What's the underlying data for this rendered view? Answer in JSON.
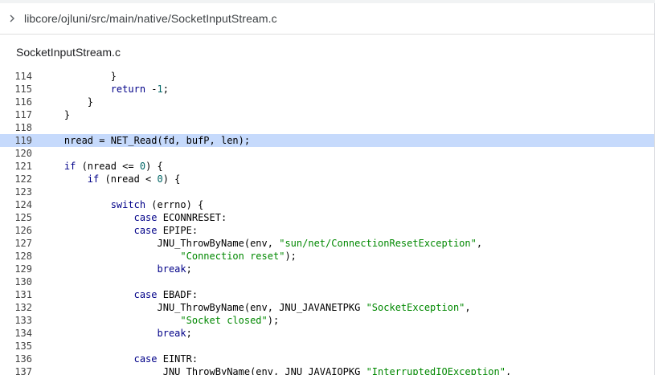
{
  "breadcrumb": {
    "path": "libcore/ojluni/src/main/native/SocketInputStream.c",
    "expand_icon": "chevron-right-icon"
  },
  "file_header": {
    "title": "SocketInputStream.c"
  },
  "code": {
    "highlighted_line": 119,
    "lines": [
      {
        "n": "114",
        "tokens": [
          {
            "t": "            }",
            "c": "pln"
          }
        ]
      },
      {
        "n": "115",
        "tokens": [
          {
            "t": "            ",
            "c": "pln"
          },
          {
            "t": "return",
            "c": "kw"
          },
          {
            "t": " -",
            "c": "pln"
          },
          {
            "t": "1",
            "c": "num"
          },
          {
            "t": ";",
            "c": "pln"
          }
        ]
      },
      {
        "n": "116",
        "tokens": [
          {
            "t": "        }",
            "c": "pln"
          }
        ]
      },
      {
        "n": "117",
        "tokens": [
          {
            "t": "    }",
            "c": "pln"
          }
        ]
      },
      {
        "n": "118",
        "tokens": [
          {
            "t": "",
            "c": "pln"
          }
        ]
      },
      {
        "n": "119",
        "tokens": [
          {
            "t": "    nread = NET_Read(fd, bufP, len);",
            "c": "pln"
          }
        ]
      },
      {
        "n": "120",
        "tokens": [
          {
            "t": "",
            "c": "pln"
          }
        ]
      },
      {
        "n": "121",
        "tokens": [
          {
            "t": "    ",
            "c": "pln"
          },
          {
            "t": "if",
            "c": "kw"
          },
          {
            "t": " (nread <= ",
            "c": "pln"
          },
          {
            "t": "0",
            "c": "num"
          },
          {
            "t": ") {",
            "c": "pln"
          }
        ]
      },
      {
        "n": "122",
        "tokens": [
          {
            "t": "        ",
            "c": "pln"
          },
          {
            "t": "if",
            "c": "kw"
          },
          {
            "t": " (nread < ",
            "c": "pln"
          },
          {
            "t": "0",
            "c": "num"
          },
          {
            "t": ") {",
            "c": "pln"
          }
        ]
      },
      {
        "n": "123",
        "tokens": [
          {
            "t": "",
            "c": "pln"
          }
        ]
      },
      {
        "n": "124",
        "tokens": [
          {
            "t": "            ",
            "c": "pln"
          },
          {
            "t": "switch",
            "c": "kw"
          },
          {
            "t": " (errno) {",
            "c": "pln"
          }
        ]
      },
      {
        "n": "125",
        "tokens": [
          {
            "t": "                ",
            "c": "pln"
          },
          {
            "t": "case",
            "c": "kw"
          },
          {
            "t": " ECONNRESET:",
            "c": "pln"
          }
        ]
      },
      {
        "n": "126",
        "tokens": [
          {
            "t": "                ",
            "c": "pln"
          },
          {
            "t": "case",
            "c": "kw"
          },
          {
            "t": " EPIPE:",
            "c": "pln"
          }
        ]
      },
      {
        "n": "127",
        "tokens": [
          {
            "t": "                    JNU_ThrowByName(env, ",
            "c": "pln"
          },
          {
            "t": "\"sun/net/ConnectionResetException\"",
            "c": "str"
          },
          {
            "t": ",",
            "c": "pln"
          }
        ]
      },
      {
        "n": "128",
        "tokens": [
          {
            "t": "                        ",
            "c": "pln"
          },
          {
            "t": "\"Connection reset\"",
            "c": "str"
          },
          {
            "t": ");",
            "c": "pln"
          }
        ]
      },
      {
        "n": "129",
        "tokens": [
          {
            "t": "                    ",
            "c": "pln"
          },
          {
            "t": "break",
            "c": "kw"
          },
          {
            "t": ";",
            "c": "pln"
          }
        ]
      },
      {
        "n": "130",
        "tokens": [
          {
            "t": "",
            "c": "pln"
          }
        ]
      },
      {
        "n": "131",
        "tokens": [
          {
            "t": "                ",
            "c": "pln"
          },
          {
            "t": "case",
            "c": "kw"
          },
          {
            "t": " EBADF:",
            "c": "pln"
          }
        ]
      },
      {
        "n": "132",
        "tokens": [
          {
            "t": "                    JNU_ThrowByName(env, JNU_JAVANETPKG ",
            "c": "pln"
          },
          {
            "t": "\"SocketException\"",
            "c": "str"
          },
          {
            "t": ",",
            "c": "pln"
          }
        ]
      },
      {
        "n": "133",
        "tokens": [
          {
            "t": "                        ",
            "c": "pln"
          },
          {
            "t": "\"Socket closed\"",
            "c": "str"
          },
          {
            "t": ");",
            "c": "pln"
          }
        ]
      },
      {
        "n": "134",
        "tokens": [
          {
            "t": "                    ",
            "c": "pln"
          },
          {
            "t": "break",
            "c": "kw"
          },
          {
            "t": ";",
            "c": "pln"
          }
        ]
      },
      {
        "n": "135",
        "tokens": [
          {
            "t": "",
            "c": "pln"
          }
        ]
      },
      {
        "n": "136",
        "tokens": [
          {
            "t": "                ",
            "c": "pln"
          },
          {
            "t": "case",
            "c": "kw"
          },
          {
            "t": " EINTR:",
            "c": "pln"
          }
        ]
      },
      {
        "n": "137",
        "tokens": [
          {
            "t": "                     JNU_ThrowByName(env, JNU_JAVAIOPKG ",
            "c": "pln"
          },
          {
            "t": "\"InterruptedIOException\"",
            "c": "str"
          },
          {
            "t": ",",
            "c": "pln"
          }
        ]
      }
    ]
  },
  "colors": {
    "highlight": "#c6dafc",
    "keyword": "#000088",
    "string": "#008800",
    "number": "#006666"
  }
}
